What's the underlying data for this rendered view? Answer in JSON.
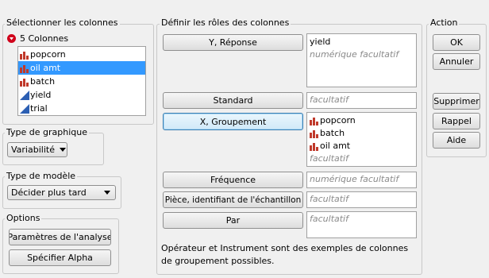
{
  "select_columns": {
    "title": "Sélectionner les colonnes",
    "count_label": "5 Colonnes",
    "columns": [
      {
        "name": "popcorn",
        "type": "nominal",
        "selected": false
      },
      {
        "name": "oil amt",
        "type": "nominal",
        "selected": true
      },
      {
        "name": "batch",
        "type": "nominal",
        "selected": false
      },
      {
        "name": "yield",
        "type": "continuous",
        "selected": false
      },
      {
        "name": "trial",
        "type": "continuous",
        "selected": false
      }
    ]
  },
  "graph_type": {
    "title": "Type de graphique",
    "value": "Variabilité"
  },
  "model_type": {
    "title": "Type de modèle",
    "value": "Décider plus tard"
  },
  "options": {
    "title": "Options",
    "analysis_settings": "Paramètres de l'analyse",
    "specify_alpha": "Spécifier Alpha"
  },
  "roles": {
    "title": "Définir les rôles des colonnes",
    "y_response": {
      "label": "Y, Réponse",
      "values": [
        "yield"
      ],
      "hint": "numérique facultatif"
    },
    "standard": {
      "label": "Standard",
      "hint": "facultatif"
    },
    "x_grouping": {
      "label": "X, Groupement",
      "values": [
        "popcorn",
        "batch",
        "oil amt"
      ],
      "hint": "facultatif"
    },
    "frequency": {
      "label": "Fréquence",
      "hint": "numérique facultatif"
    },
    "part_id": {
      "label": "Pièce, identifiant de l'échantillon",
      "hint": "facultatif"
    },
    "by": {
      "label": "Par",
      "hint": "facultatif"
    },
    "footnote": "Opérateur et Instrument sont des exemples de colonnes de groupement possibles."
  },
  "action": {
    "title": "Action",
    "ok": "OK",
    "cancel": "Annuler",
    "remove": "Supprimer",
    "recall": "Rappel",
    "help": "Aide"
  },
  "colors": {
    "selection": "#3399ff",
    "nominal_icon": "#c0392b",
    "continuous_icon": "#2c5fb3",
    "collapse_icon": "#d0021b"
  }
}
